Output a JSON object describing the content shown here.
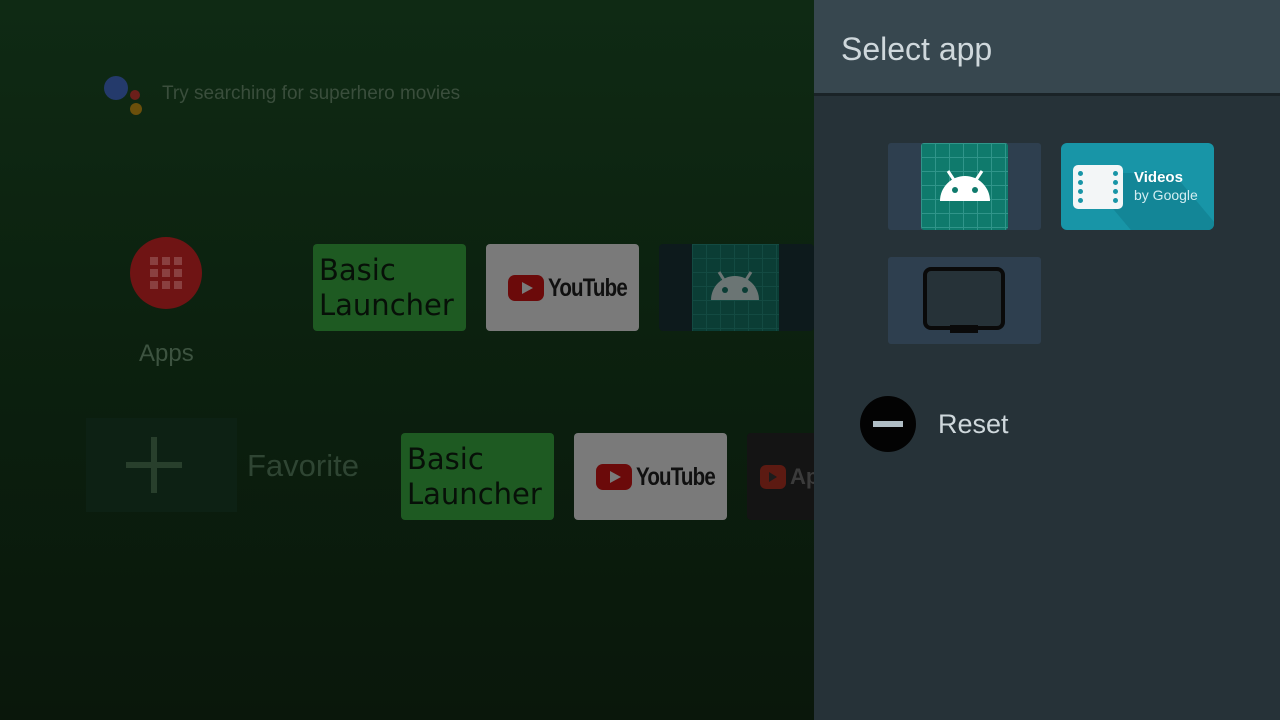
{
  "launcher": {
    "search_hint": "Try searching for superhero movies",
    "apps_label": "Apps",
    "row1": [
      {
        "kind": "text",
        "label": "Basic\nLauncher"
      },
      {
        "kind": "youtube",
        "label": "YouTube"
      },
      {
        "kind": "android",
        "label": ""
      }
    ],
    "favorite_label": "Favorite",
    "row2": [
      {
        "kind": "text",
        "label": "Basic\nLauncher"
      },
      {
        "kind": "youtube",
        "label": "YouTube"
      },
      {
        "kind": "ap",
        "label": "Ap"
      }
    ],
    "basic_launcher_line1": "Basic",
    "basic_launcher_line2": "Launcher",
    "youtube": "YouTube",
    "ap_partial": "Ap"
  },
  "panel": {
    "title": "Select app",
    "apps": [
      {
        "icon": "android-icon"
      },
      {
        "icon": "videos-icon",
        "name": "Videos",
        "sub": "by Google"
      },
      {
        "icon": "tv-icon"
      }
    ],
    "reset_label": "Reset"
  },
  "colors": {
    "panel_bg": "#263238",
    "panel_header": "#37474f",
    "videos_tile": "#1895a7",
    "android_green": "#0f7a6c"
  }
}
